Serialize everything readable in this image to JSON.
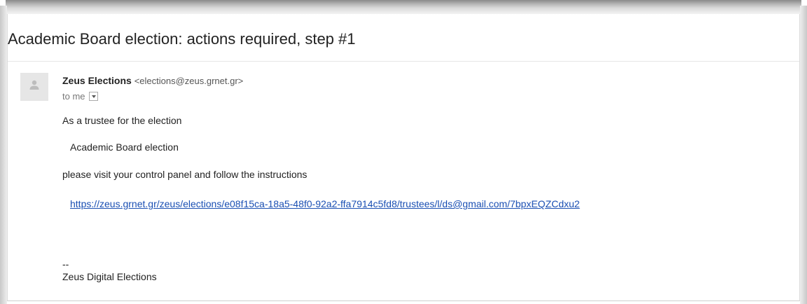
{
  "email": {
    "subject": "Academic Board election: actions required, step #1",
    "sender": {
      "name": "Zeus Elections",
      "email": "<elections@zeus.grnet.gr>"
    },
    "recipient_label": "to me",
    "body": {
      "line1": "As a trustee for the election",
      "election_name": "Academic Board election",
      "line3": "please visit your control panel and follow the instructions",
      "link": "https://zeus.grnet.gr/zeus/elections/e08f15ca-18a5-48f0-92a2-ffa7914c5fd8/trustees/l/ds@gmail.com/7bpxEQZCdxu2",
      "signature_separator": "--",
      "signature": "Zeus Digital Elections"
    }
  },
  "icons": {
    "avatar": "person-avatar-icon",
    "details": "chevron-down-icon"
  },
  "colors": {
    "link": "#1a4fb3",
    "text": "#222222",
    "muted": "#777777"
  }
}
